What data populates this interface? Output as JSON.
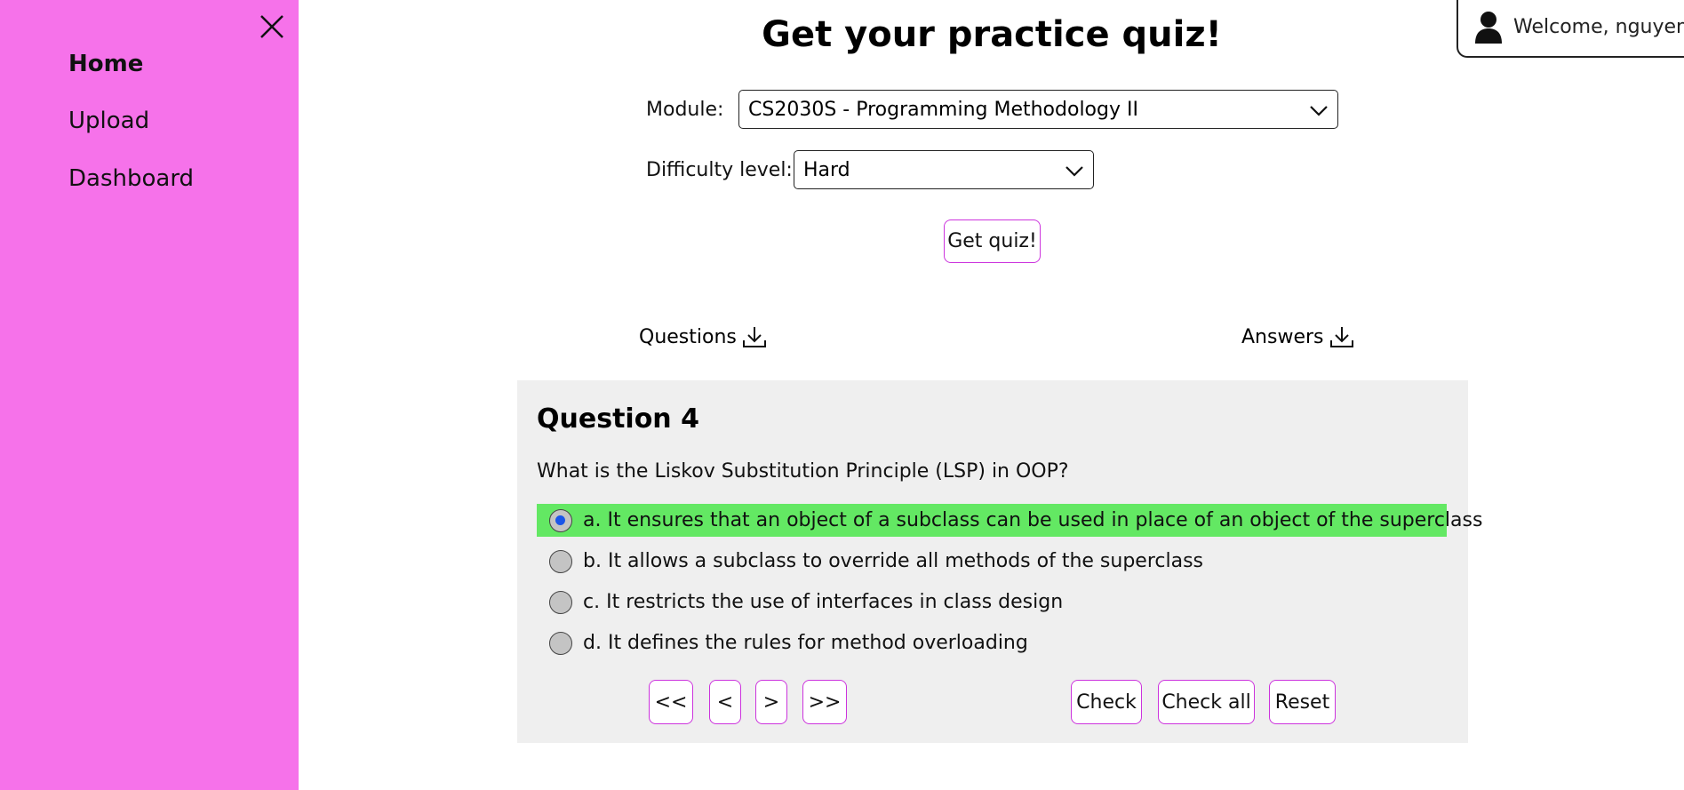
{
  "sidebar": {
    "close_label": "Close menu",
    "items": [
      {
        "label": "Home",
        "active": true
      },
      {
        "label": "Upload",
        "active": false
      },
      {
        "label": "Dashboard",
        "active": false
      }
    ]
  },
  "header": {
    "welcome_text": "Welcome, nguyen"
  },
  "page": {
    "title": "Get your practice quiz!"
  },
  "form": {
    "module_label": "Module:",
    "module_value": "CS2030S - Programming Methodology II",
    "difficulty_label": "Difficulty level:",
    "difficulty_value": "Hard",
    "get_quiz_label": "Get quiz!"
  },
  "downloads": {
    "questions_label": "Questions",
    "answers_label": "Answers"
  },
  "quiz": {
    "question_title": "Question 4",
    "question_text": "What is the Liskov Substitution Principle (LSP) in OOP?",
    "options": [
      {
        "label": "a. It ensures that an object of a subclass can be used in place of an object of the superclass",
        "selected": true,
        "correct": true
      },
      {
        "label": "b. It allows a subclass to override all methods of the superclass",
        "selected": false,
        "correct": false
      },
      {
        "label": "c. It restricts the use of interfaces in class design",
        "selected": false,
        "correct": false
      },
      {
        "label": "d. It defines the rules for method overloading",
        "selected": false,
        "correct": false
      }
    ],
    "nav": {
      "first": "<<",
      "prev": "<",
      "next": ">",
      "last": ">>"
    },
    "actions": {
      "check": "Check",
      "check_all": "Check all",
      "reset": "Reset"
    }
  },
  "colors": {
    "sidebar_bg": "#f672ea",
    "button_border": "#cc33dd",
    "correct_bg": "#63e863",
    "radio_selected": "#1a56e8",
    "card_bg": "#efefef"
  }
}
